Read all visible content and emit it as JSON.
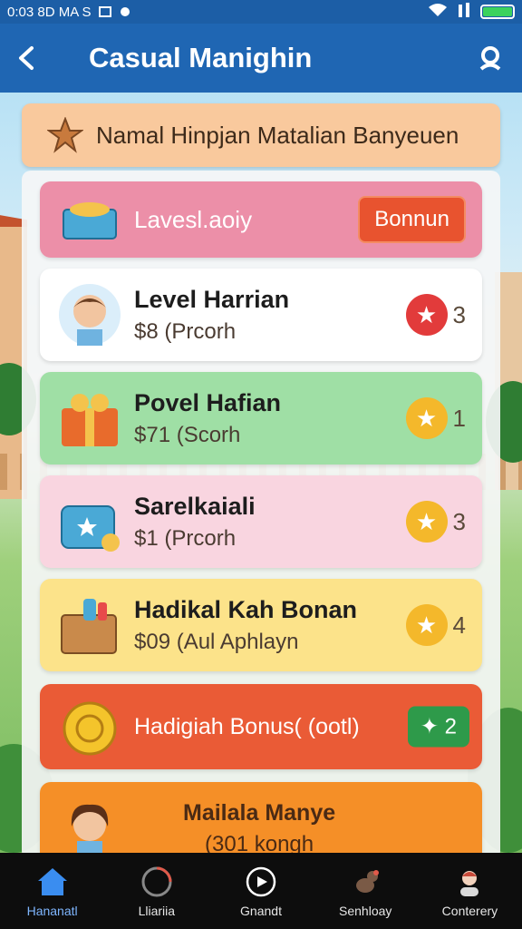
{
  "status": {
    "time": "0:03 8D MA S",
    "icons": [
      "wifi-icon",
      "signal-icon",
      "battery-icon"
    ]
  },
  "header": {
    "title": "Casual Manighin",
    "back": "back-icon",
    "search": "search-icon"
  },
  "banner": {
    "text": "Namal Hinpjan Matalian Banyeuen"
  },
  "list": [
    {
      "title": "Lavesl.aoiy",
      "action": "Bonnun"
    },
    {
      "title": "Level Harrian",
      "sub": "$8 (Prcorh",
      "count": "3",
      "star": "red"
    },
    {
      "title": "Povel Hafian",
      "sub": "$71 (Scorh",
      "count": "1",
      "star": "yellow"
    },
    {
      "title": "Sarelkaiali",
      "sub": "$1 (Prcorh",
      "count": "3",
      "star": "yellow"
    },
    {
      "title": "Hadikal Kah Bonan",
      "sub": "$09 (Aul Aphlayn",
      "count": "4",
      "star": "yellow"
    },
    {
      "title": "Hadigiah Bonus( (ootl)",
      "pill": "✦ 2"
    },
    {
      "title": "Mailala Manye",
      "sub": "(301 kongh"
    }
  ],
  "nav": [
    {
      "label": "Hananatl",
      "icon": "home-icon"
    },
    {
      "label": "Lliariia",
      "icon": "chart-icon"
    },
    {
      "label": "Gnandt",
      "icon": "play-icon"
    },
    {
      "label": "Senhloay",
      "icon": "pet-icon"
    },
    {
      "label": "Conterery",
      "icon": "profile-icon"
    }
  ],
  "colors": {
    "appbar": "#1f66b3",
    "accent": "#e8532f",
    "green": "#2e9a4a"
  }
}
